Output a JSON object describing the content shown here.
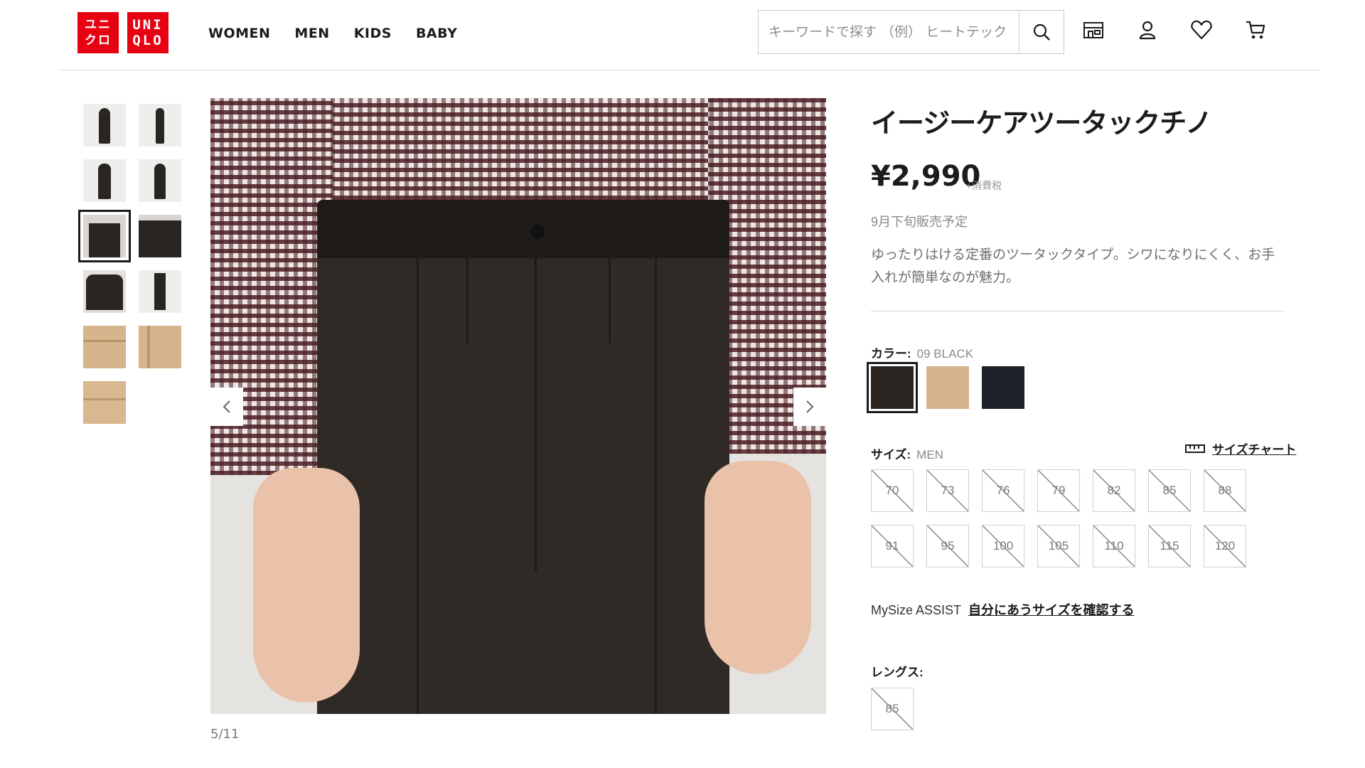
{
  "header": {
    "logo": {
      "line1": "ユニ クロ",
      "line2": "UNI QLO"
    },
    "nav": [
      "WOMEN",
      "MEN",
      "KIDS",
      "BABY"
    ],
    "search": {
      "placeholder": "キーワードで探す （例） ヒートテック",
      "value": ""
    },
    "icons": [
      "search-icon",
      "store-icon",
      "user-icon",
      "heart-icon",
      "cart-icon"
    ]
  },
  "gallery": {
    "thumbnail_count": 11,
    "active_index": 5,
    "counter": "5/11",
    "prev_label": "‹",
    "next_label": "›"
  },
  "product": {
    "title": "イージーケアツータックチノ",
    "price": "¥2,990",
    "tax_note": "+消費税",
    "release_note": "9月下旬販売予定",
    "description": "ゆったりはける定番のツータックタイプ。シワになりにくく、お手入れが簡単なのが魅力。",
    "color": {
      "label": "カラー:",
      "selected": "09 BLACK",
      "swatches": [
        {
          "name": "09 BLACK",
          "hex": "#2a2420"
        },
        {
          "name": "beige",
          "hex": "#d8b48e"
        },
        {
          "name": "navy",
          "hex": "#1e2229"
        }
      ]
    },
    "size": {
      "label": "サイズ:",
      "category": "MEN",
      "chart_link": "サイズチャート",
      "options": [
        "70",
        "73",
        "76",
        "79",
        "82",
        "85",
        "88",
        "91",
        "95",
        "100",
        "105",
        "110",
        "115",
        "120"
      ]
    },
    "mysize": {
      "label": "MySize ASSIST",
      "link": "自分にあうサイズを確認する"
    },
    "length": {
      "label": "レングス:",
      "options": [
        "85"
      ]
    }
  },
  "colors": {
    "brand_red": "#e60012"
  }
}
